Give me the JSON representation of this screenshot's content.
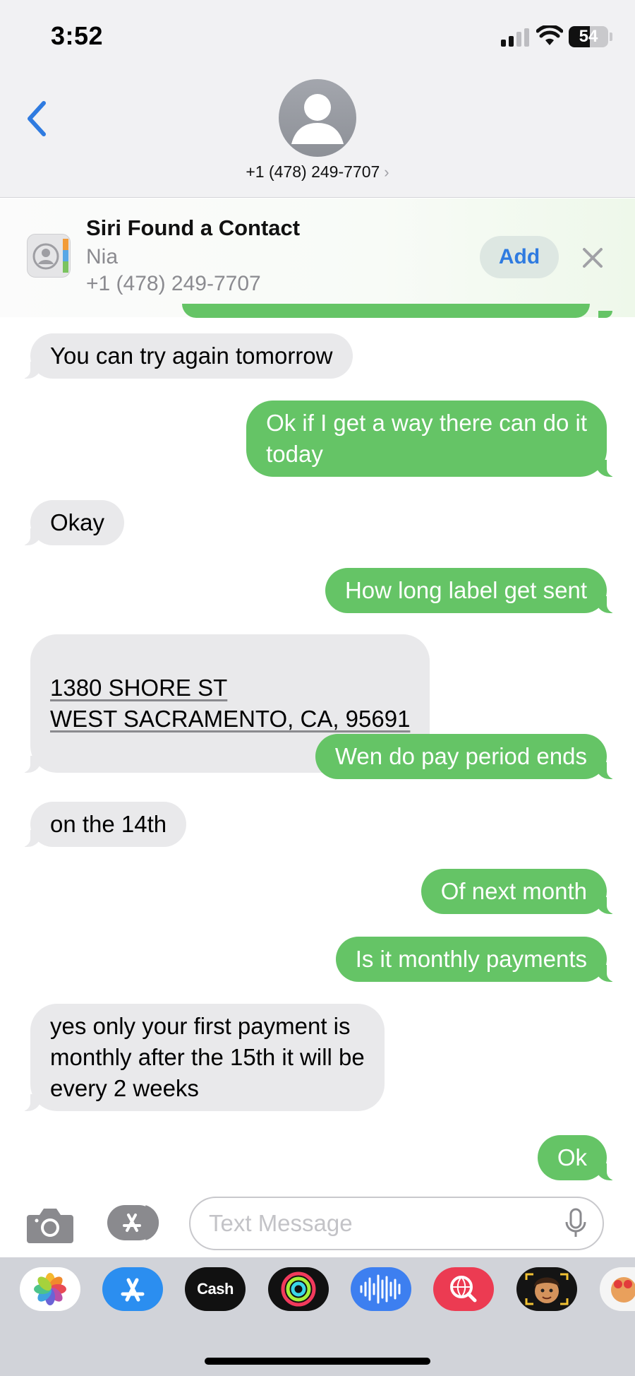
{
  "status_bar": {
    "time": "3:52",
    "battery": "54",
    "battery_level": 0.54,
    "icons": [
      "cellular-signal-icon",
      "wifi-icon",
      "battery-icon"
    ]
  },
  "header": {
    "back_icon": "chevron-left-icon",
    "contact_number": "+1 (478) 249-7707",
    "disclosure": "›"
  },
  "siri_suggestion": {
    "title": "Siri Found a Contact",
    "name": "Nia",
    "phone": "+1 (478) 249-7707",
    "add_label": "Add",
    "close_icon": "close-icon"
  },
  "messages": [
    {
      "from": "contact",
      "text": "You can try again tomorrow"
    },
    {
      "from": "me",
      "text": "Ok if I get a way there can do it\ntoday"
    },
    {
      "from": "contact",
      "text": "Okay"
    },
    {
      "from": "me",
      "text": "How long label get sent"
    },
    {
      "from": "contact",
      "line1": "1380 SHORE ST",
      "line2": "WEST SACRAMENTO, CA, 95691"
    },
    {
      "from": "me",
      "text": "Wen do  pay period ends"
    },
    {
      "from": "contact",
      "text": "on the 14th"
    },
    {
      "from": "me",
      "text": "Of next month"
    },
    {
      "from": "me",
      "text": "Is it monthly payments"
    },
    {
      "from": "contact",
      "text": "yes only your first payment is\nmonthly after the 15th it will be\nevery 2 weeks"
    },
    {
      "from": "me",
      "text": "Ok"
    }
  ],
  "compose": {
    "placeholder": "Text Message",
    "value": ""
  },
  "app_tray": [
    {
      "name": "photos-app",
      "icon": "photos-icon"
    },
    {
      "name": "app-store-app",
      "icon": "app-store-icon"
    },
    {
      "name": "apple-cash-app",
      "label": "Cash"
    },
    {
      "name": "fitness-app",
      "icon": "activity-rings-icon"
    },
    {
      "name": "audio-message-app",
      "icon": "audio-waveform-icon"
    },
    {
      "name": "image-search-app",
      "icon": "globe-search-icon"
    },
    {
      "name": "memoji-app",
      "icon": "memoji-icon"
    },
    {
      "name": "memoji-stickers-app",
      "icon": "memoji-stickers-icon"
    }
  ],
  "colors": {
    "outgoing_bubble": "#65c466",
    "incoming_bubble": "#e9e9eb",
    "accent_blue": "#2f7be0"
  }
}
